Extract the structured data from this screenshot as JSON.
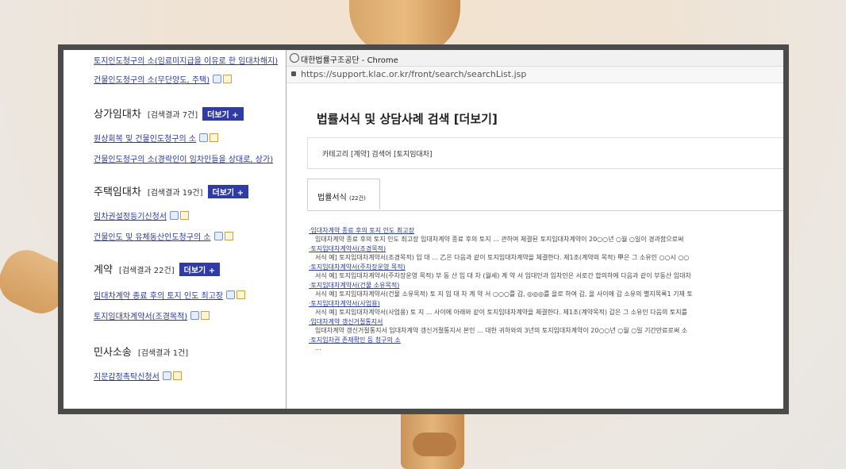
{
  "popup": {
    "window_title": "대한법률구조공단 - Chrome",
    "url": "https://support.klac.or.kr/front/search/searchList.jsp",
    "page_title": "법률서식 및 상담사례 검색 [더보기]",
    "filter": "카테고리 [계약]    검색어 [토지임대차]",
    "tab_label": "법률서식",
    "tab_count": "(22건)",
    "results": [
      {
        "title": "·임대차계약 종료 후의 토지 인도 최고장",
        "desc": "임대차계약 종료 후의 토지 인도 최고장 임대차계약 종료 후의 토지 ... 관하여 체결된 토지임대차계약이 20○○년 ○월 ○일이 경과함으로써"
      },
      {
        "title": "·토지임대차계약서(조경목적)",
        "desc": "서식 예] 토지임대차계약서(조경목적) 임 대 ... 乙은 다음과 같이 토지임대차계약을 체결한다. 제1조(계약의 목적) 甲은 그 소유인 ○○시 ○○"
      },
      {
        "title": "·토지임대차계약서(주차장운영 목적)",
        "desc": "서식 예] 토지임대차계약서(주차장운영 목적) 부 동 산 임 대 차 (월세) 계 약 서 임대인과 임차인은 서로간 합의하에 다음과 같이 부동산 임대차"
      },
      {
        "title": "·토지임대차계약서(건물 소유목적)",
        "desc": "서식 예] 토지임대차계약서(건물 소유목적) 토 지 임 대 차 계 약 서 ○○○를 갑, ◎◎◎를 을로 하여 갑, 을 사이에 갑 소유의 별지목록1 기재 토"
      },
      {
        "title": "·토지임대차계약서(사업용)",
        "desc": "서식 예] 토지임대차계약서(사업용) 토 지 ... 사이에 아래와 같이 토지임대차계약을 체결한다. 제1조(계약목적) 갑은 그 소유인 다음의 토지를"
      },
      {
        "title": "·임대차계약 갱신거절통지서",
        "desc": "임대차계약 갱신거절통지서 임대차계약 갱신거절통지서 본인 ... 대한 귀하와의 3년의 토지임대차계약이 20○○년 ○월 ○일 기간만료로써 소"
      },
      {
        "title": "·토지임차권 존재확인 등 청구의 소",
        "desc": "..."
      }
    ]
  },
  "left": {
    "items_top": [
      "토지인도청구의 소(임료미지급을 이유로 한 임대차해지)",
      "건물인도청구의 소(무단양도, 주택)"
    ],
    "sections": [
      {
        "title": "상가임대차",
        "count": "[검색결과 7건]",
        "more": "더보기 +",
        "items": [
          "원상회복 및 건물인도청구의 소",
          "건물인도청구의 소(경락인이 임차인들을 상대로, 상가)"
        ]
      },
      {
        "title": "주택임대차",
        "count": "[검색결과 19건]",
        "more": "더보기 +",
        "items": [
          "임차권설정등기신청서",
          "건물인도 및 유체동산인도청구의 소"
        ]
      },
      {
        "title": "계약",
        "count": "[검색결과 22건]",
        "more": "더보기 +",
        "items": [
          "임대차계약 종료 후의 토지 인도 최고장",
          "토지임대차계약서(조경목적)"
        ]
      },
      {
        "title": "민사소송",
        "count": "[검색결과 1건]",
        "more": "",
        "items": [
          "지문감정촉탁신청서"
        ]
      }
    ]
  }
}
